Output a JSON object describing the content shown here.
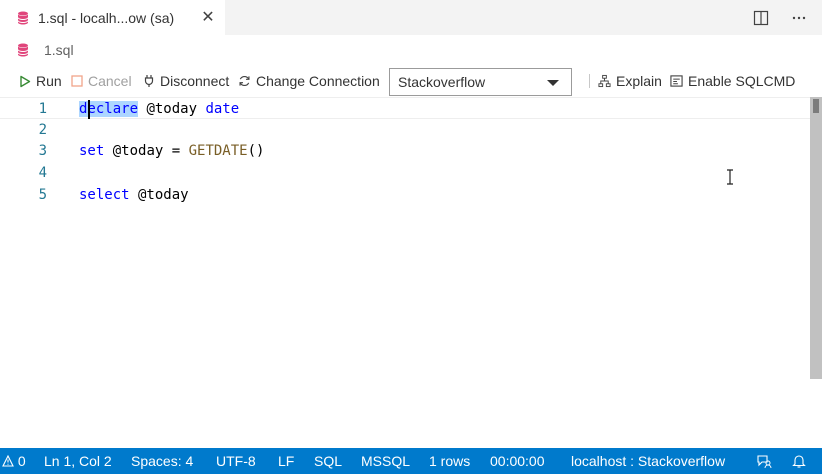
{
  "tab": {
    "title": "1.sql - localh...ow (sa)",
    "close_glyph": "✕"
  },
  "tab_actions": [
    "split-editor-icon",
    "more-actions-icon"
  ],
  "breadcrumb": {
    "file": "1.sql"
  },
  "toolbar": {
    "run": "Run",
    "cancel": "Cancel",
    "disconnect": "Disconnect",
    "change_connection": "Change Connection",
    "database": "Stackoverflow",
    "explain": "Explain",
    "sqlcmd": "Enable SQLCMD"
  },
  "editor": {
    "lines": [
      {
        "num": "1",
        "tokens": [
          [
            "kw",
            "declare"
          ],
          [
            "",
            ""
          ],
          [
            "plain",
            " @today "
          ],
          [
            "kw",
            "date"
          ]
        ]
      },
      {
        "num": "2",
        "tokens": []
      },
      {
        "num": "3",
        "tokens": [
          [
            "kw",
            "set"
          ],
          [
            "plain",
            " @today = "
          ],
          [
            "fn",
            "GETDATE"
          ],
          [
            "plain",
            "()"
          ]
        ]
      },
      {
        "num": "4",
        "tokens": []
      },
      {
        "num": "5",
        "tokens": [
          [
            "kw",
            "select"
          ],
          [
            "plain",
            " @today"
          ]
        ]
      }
    ]
  },
  "statusbar": {
    "problems": "0",
    "position": "Ln 1, Col 2",
    "spaces": "Spaces: 4",
    "encoding": "UTF-8",
    "eol": "LF",
    "language": "SQL",
    "provider": "MSSQL",
    "rows": "1 rows",
    "time": "00:00:00",
    "connection": "localhost : Stackoverflow"
  },
  "colors": {
    "accent": "#007acc",
    "keyword": "#0000ff",
    "function": "#795e26",
    "line_number": "#237893",
    "db_icon": "#e0457b"
  }
}
